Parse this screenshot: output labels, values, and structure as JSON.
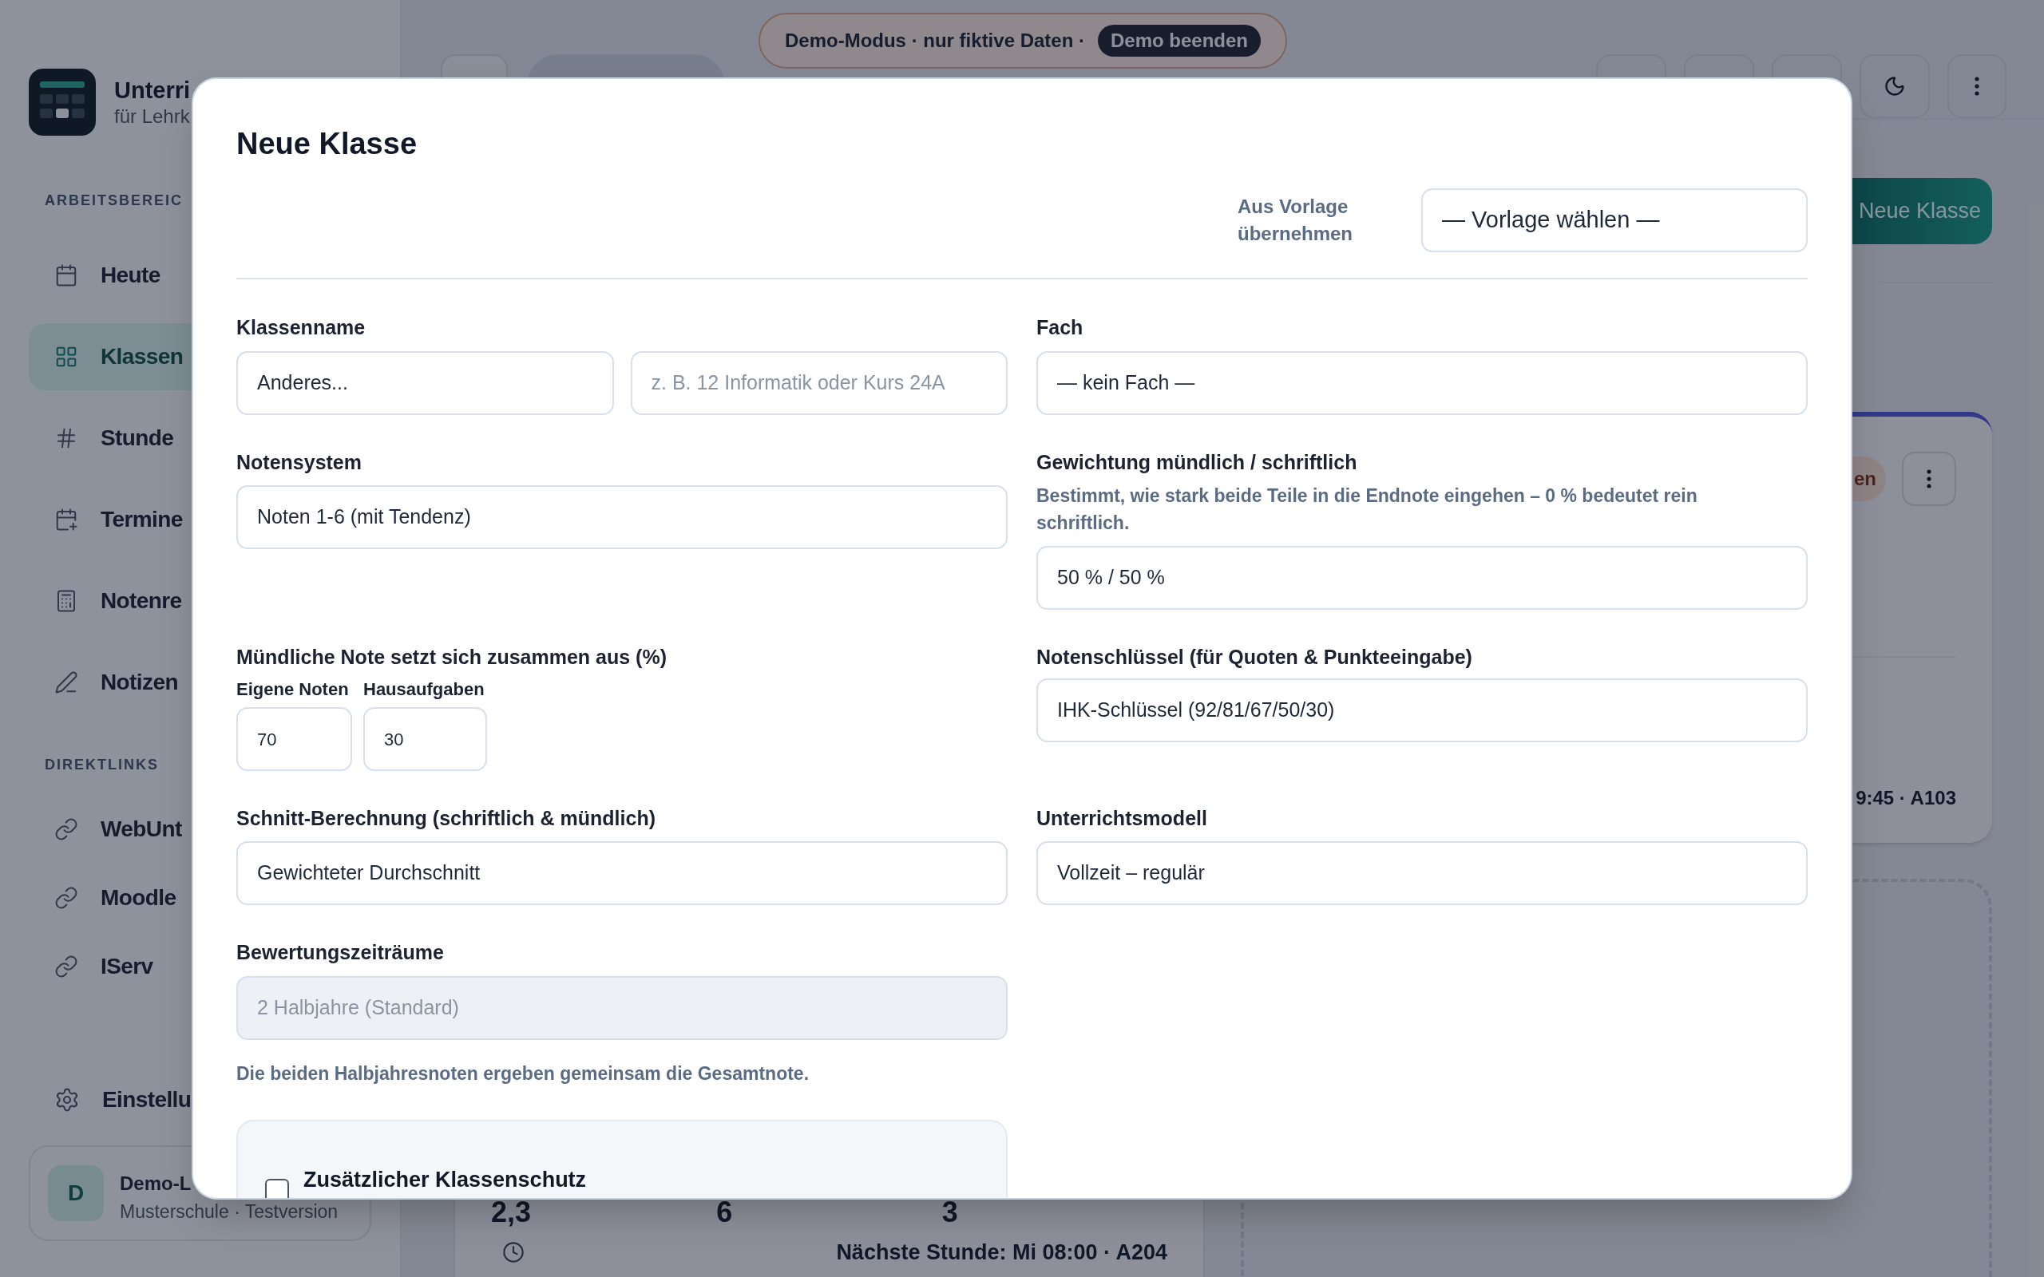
{
  "sidebar": {
    "app_title": "Unterri",
    "app_subtitle": "für Lehrk",
    "workspace_label": "ARBEITSBEREIC",
    "workspace_items": [
      {
        "label": "Heute",
        "selected": false
      },
      {
        "label": "Klassen",
        "selected": true
      },
      {
        "label": "Stunde",
        "selected": false
      },
      {
        "label": "Termine",
        "selected": false
      },
      {
        "label": "Notenre",
        "selected": false
      },
      {
        "label": "Notizen",
        "selected": false
      }
    ],
    "links_label": "DIREKTLINKS",
    "links": [
      "WebUnt",
      "Moodle",
      "IServ"
    ],
    "settings": "Einstellu",
    "user": {
      "initial": "D",
      "name": "Demo-L",
      "detail": "Musterschule · Testversion"
    }
  },
  "demo_banner": {
    "text": "Demo-Modus · nur fiktive Daten ·",
    "button": "Demo beenden"
  },
  "main": {
    "new_class_button": "Neue Klasse",
    "class_card": {
      "badge": "en",
      "schedule": "9:45 · A103"
    },
    "second_card": {
      "stats": [
        "2,3",
        "6",
        "3"
      ],
      "next_lesson": "Nächste Stunde: Mi 08:00 · A204"
    }
  },
  "dialog": {
    "title": "Neue Klasse",
    "template": {
      "label": "Aus Vorlage übernehmen",
      "value": "— Vorlage wählen —"
    },
    "class_name": {
      "label": "Klassenname",
      "value": "Anderes...",
      "placeholder": "z. B. 12 Informatik oder Kurs 24A"
    },
    "subject": {
      "label": "Fach",
      "value": "— kein Fach —"
    },
    "grading_system": {
      "label": "Notensystem",
      "value": "Noten 1-6 (mit Tendenz)"
    },
    "weighting": {
      "label": "Gewichtung mündlich / schriftlich",
      "help": "Bestimmt, wie stark beide Teile in die Endnote eingehen – 0 % bedeutet rein schriftlich.",
      "value": "50 % / 50 %"
    },
    "oral_composition": {
      "label": "Mündliche Note setzt sich zusammen aus (%)",
      "parts": [
        {
          "label": "Eigene Noten",
          "value": "70"
        },
        {
          "label": "Hausaufgaben",
          "value": "30"
        }
      ]
    },
    "grade_key": {
      "label": "Notenschlüssel (für Quoten & Punkteeingabe)",
      "value": "IHK-Schlüssel (92/81/67/50/30)"
    },
    "average": {
      "label": "Schnitt-Berechnung (schriftlich & mündlich)",
      "value": "Gewichteter Durchschnitt"
    },
    "teaching_model": {
      "label": "Unterrichtsmodell",
      "value": "Vollzeit – regulär"
    },
    "periods": {
      "label": "Bewertungszeiträume",
      "value": "2 Halbjahre (Standard)",
      "disabled": true,
      "help": "Die beiden Halbjahresnoten ergeben gemeinsam die Gesamtnote."
    },
    "protection": {
      "label": "Zusätzlicher Klassenschutz",
      "checked": false
    }
  }
}
